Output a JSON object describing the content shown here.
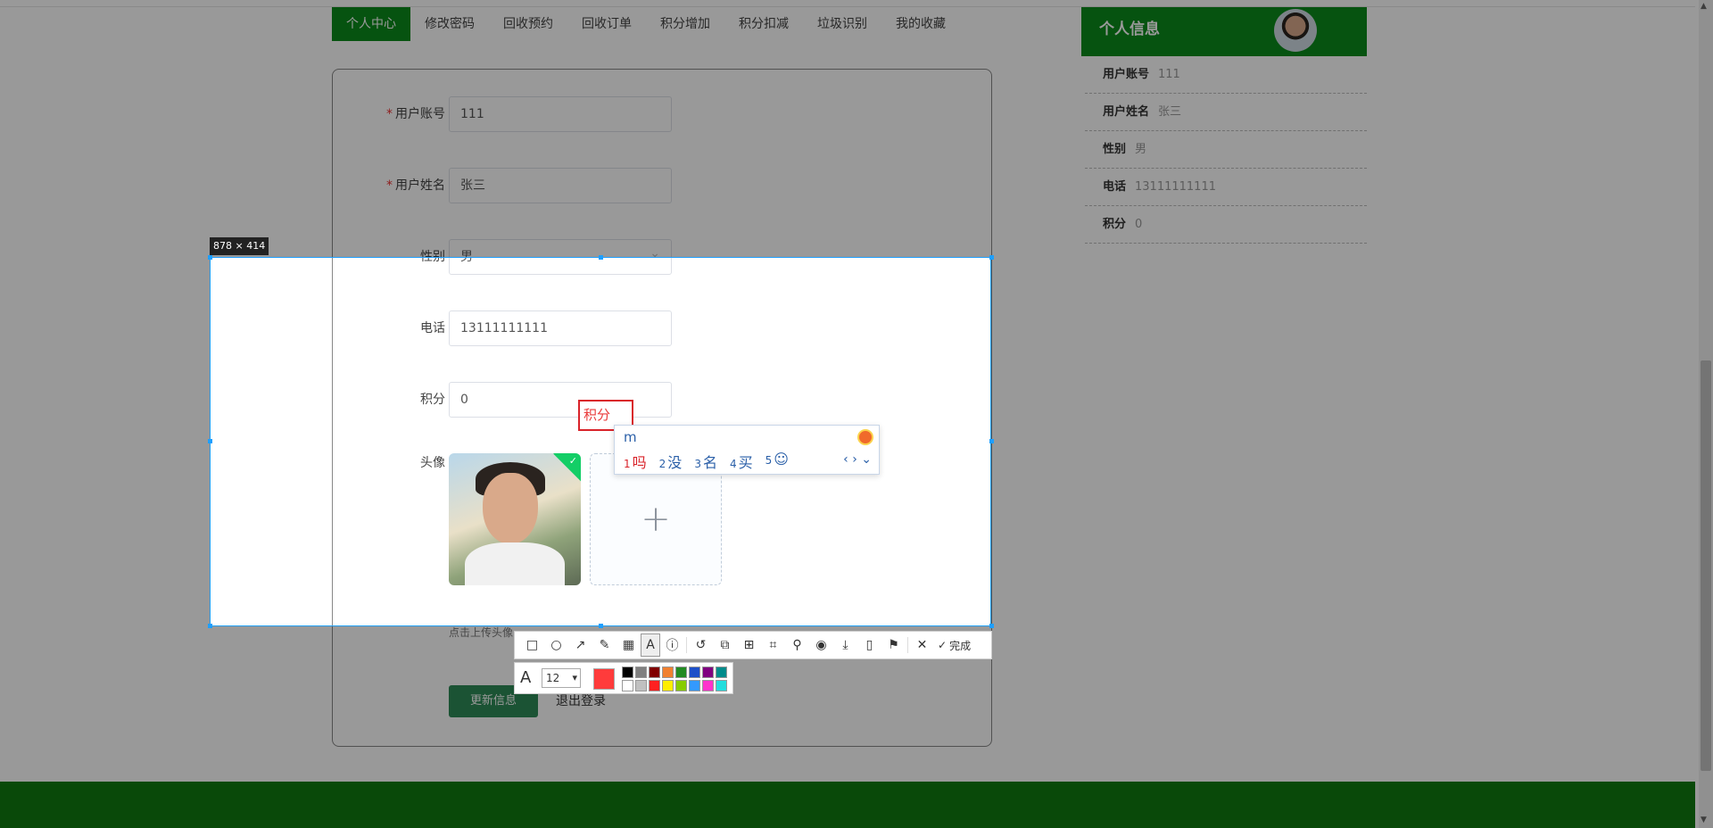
{
  "nav": {
    "items": [
      "个人中心",
      "修改密码",
      "回收预约",
      "回收订单",
      "积分增加",
      "积分扣减",
      "垃圾识别",
      "我的收藏"
    ],
    "active_index": 0
  },
  "form": {
    "account_label": "用户账号",
    "account_value": "111",
    "name_label": "用户姓名",
    "name_value": "张三",
    "gender_label": "性别",
    "gender_value": "男",
    "phone_label": "电话",
    "phone_value": "13111111111",
    "points_label": "积分",
    "points_value": "0",
    "avatar_label": "头像",
    "required_mark": "*",
    "upload_hint": "点击上传头像",
    "update_button": "更新信息",
    "logout_button": "退出登录"
  },
  "info_panel": {
    "title": "个人信息",
    "rows": [
      {
        "key": "用户账号",
        "value": "111"
      },
      {
        "key": "用户姓名",
        "value": "张三"
      },
      {
        "key": "性别",
        "value": "男"
      },
      {
        "key": "电话",
        "value": "13111111111"
      },
      {
        "key": "积分",
        "value": "0"
      }
    ]
  },
  "screenshot_tool": {
    "size_label": "878 × 414",
    "text_annotation": "积分",
    "font_size": "12",
    "done_label": "完成",
    "current_color": "#ff3b3b",
    "swatches": [
      "#000000",
      "#808080",
      "#800000",
      "#f08030",
      "#228b22",
      "#1e50c8",
      "#800080",
      "#008b8b",
      "#ffffff",
      "#c0c0c0",
      "#ff2020",
      "#ffee00",
      "#88cc00",
      "#3399ff",
      "#ff33cc",
      "#22dddd"
    ]
  },
  "ime": {
    "input": "m",
    "candidates": [
      {
        "n": "1",
        "text": "吗"
      },
      {
        "n": "2",
        "text": "没"
      },
      {
        "n": "3",
        "text": "名"
      },
      {
        "n": "4",
        "text": "买"
      },
      {
        "n": "5",
        "text": ""
      }
    ]
  },
  "colors": {
    "brand_green": "#0b8a1c",
    "footer_green": "#0f7a0f",
    "selection_blue": "#1e9fff",
    "annotation_red": "#d9232a"
  }
}
